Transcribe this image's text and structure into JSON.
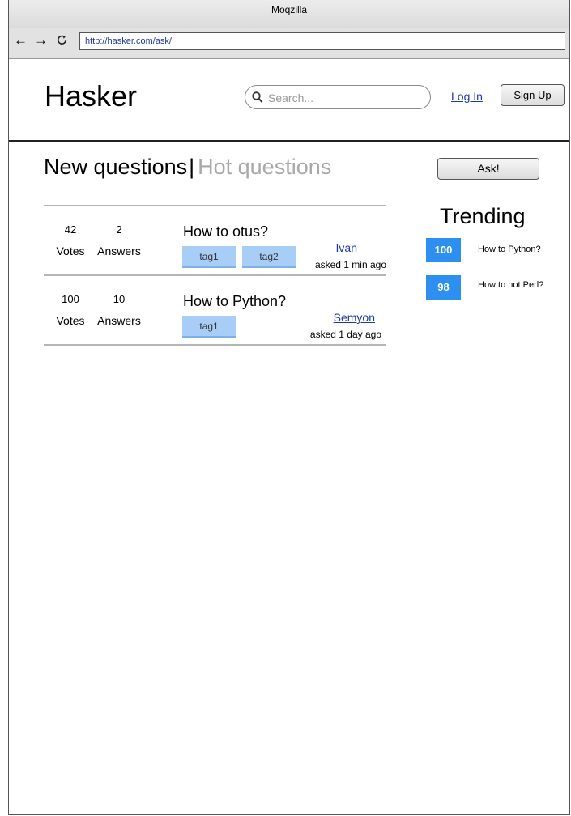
{
  "browser": {
    "window_title": "Moqzilla",
    "url": "http://hasker.com/ask/"
  },
  "header": {
    "logo": "Hasker",
    "search_placeholder": "Search...",
    "login_label": "Log In",
    "signup_label": "Sign Up"
  },
  "tabs": {
    "new_label": "New questions",
    "separator": "|",
    "hot_label": "Hot questions"
  },
  "ask_label": "Ask!",
  "questions": [
    {
      "votes": "42",
      "votes_label": "Votes",
      "answers": "2",
      "answers_label": "Answers",
      "title": "How to otus?",
      "tags": [
        "tag1",
        "tag2"
      ],
      "author": "Ivan",
      "asked": "asked 1 min ago"
    },
    {
      "votes": "100",
      "votes_label": "Votes",
      "answers": "10",
      "answers_label": "Answers",
      "title": "How to Python?",
      "tags": [
        "tag1"
      ],
      "author": "Semyon",
      "asked": "asked 1 day ago"
    }
  ],
  "trending": {
    "title": "Trending",
    "items": [
      {
        "score": "100",
        "title": "How to Python?"
      },
      {
        "score": "98",
        "title": "How to not Perl?"
      }
    ]
  },
  "colors": {
    "accent": "#2d8ff0",
    "tag": "#a8cdf7",
    "link": "#1a3aa6",
    "muted_tab": "#a9a9a9"
  }
}
